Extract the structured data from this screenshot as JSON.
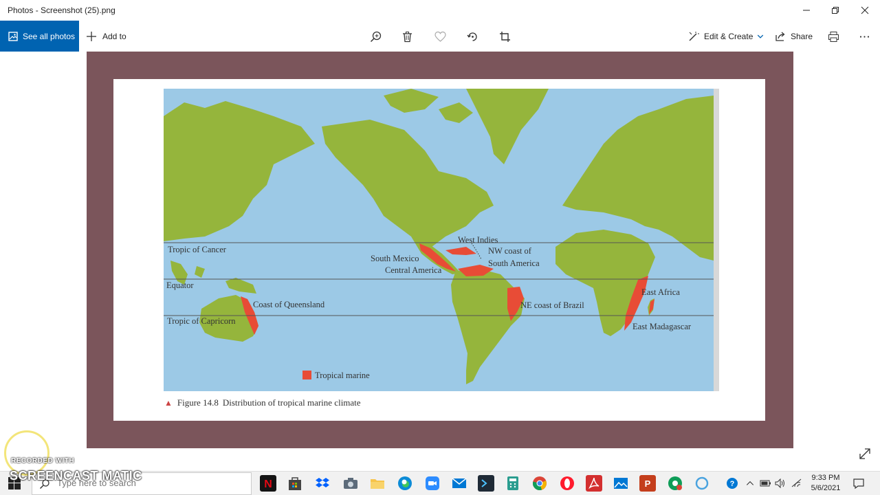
{
  "window": {
    "title": "Photos - Screenshot (25).png"
  },
  "toolbar": {
    "see_all_photos": "See all photos",
    "add_to": "Add to",
    "edit_create": "Edit & Create",
    "share": "Share"
  },
  "figure": {
    "caption_number": "Figure 14.8",
    "caption_text": "Distribution of tropical marine climate",
    "legend_label": "Tropical marine",
    "lines": {
      "cancer": "Tropic of Cancer",
      "equator": "Equator",
      "capricorn": "Tropic of Capricorn"
    },
    "regions": {
      "west_indies": "West Indies",
      "nw_coast_1": "NW coast of",
      "nw_coast_2": "South America",
      "south_mexico": "South Mexico",
      "central_america": "Central America",
      "queensland": "Coast of Queensland",
      "ne_brazil": "NE coast of Brazil",
      "east_africa": "East Africa",
      "east_madagascar": "East Madagascar"
    },
    "colors": {
      "ocean": "#9cc9e6",
      "land": "#95b53c",
      "tropical_marine": "#e84c36"
    }
  },
  "watermark": {
    "recorded": "RECORDED WITH",
    "brand": "SCREENCAST  MATIC"
  },
  "taskbar": {
    "search_placeholder": "Type here to search",
    "time": "9:33 PM",
    "date": "5/6/2021"
  }
}
